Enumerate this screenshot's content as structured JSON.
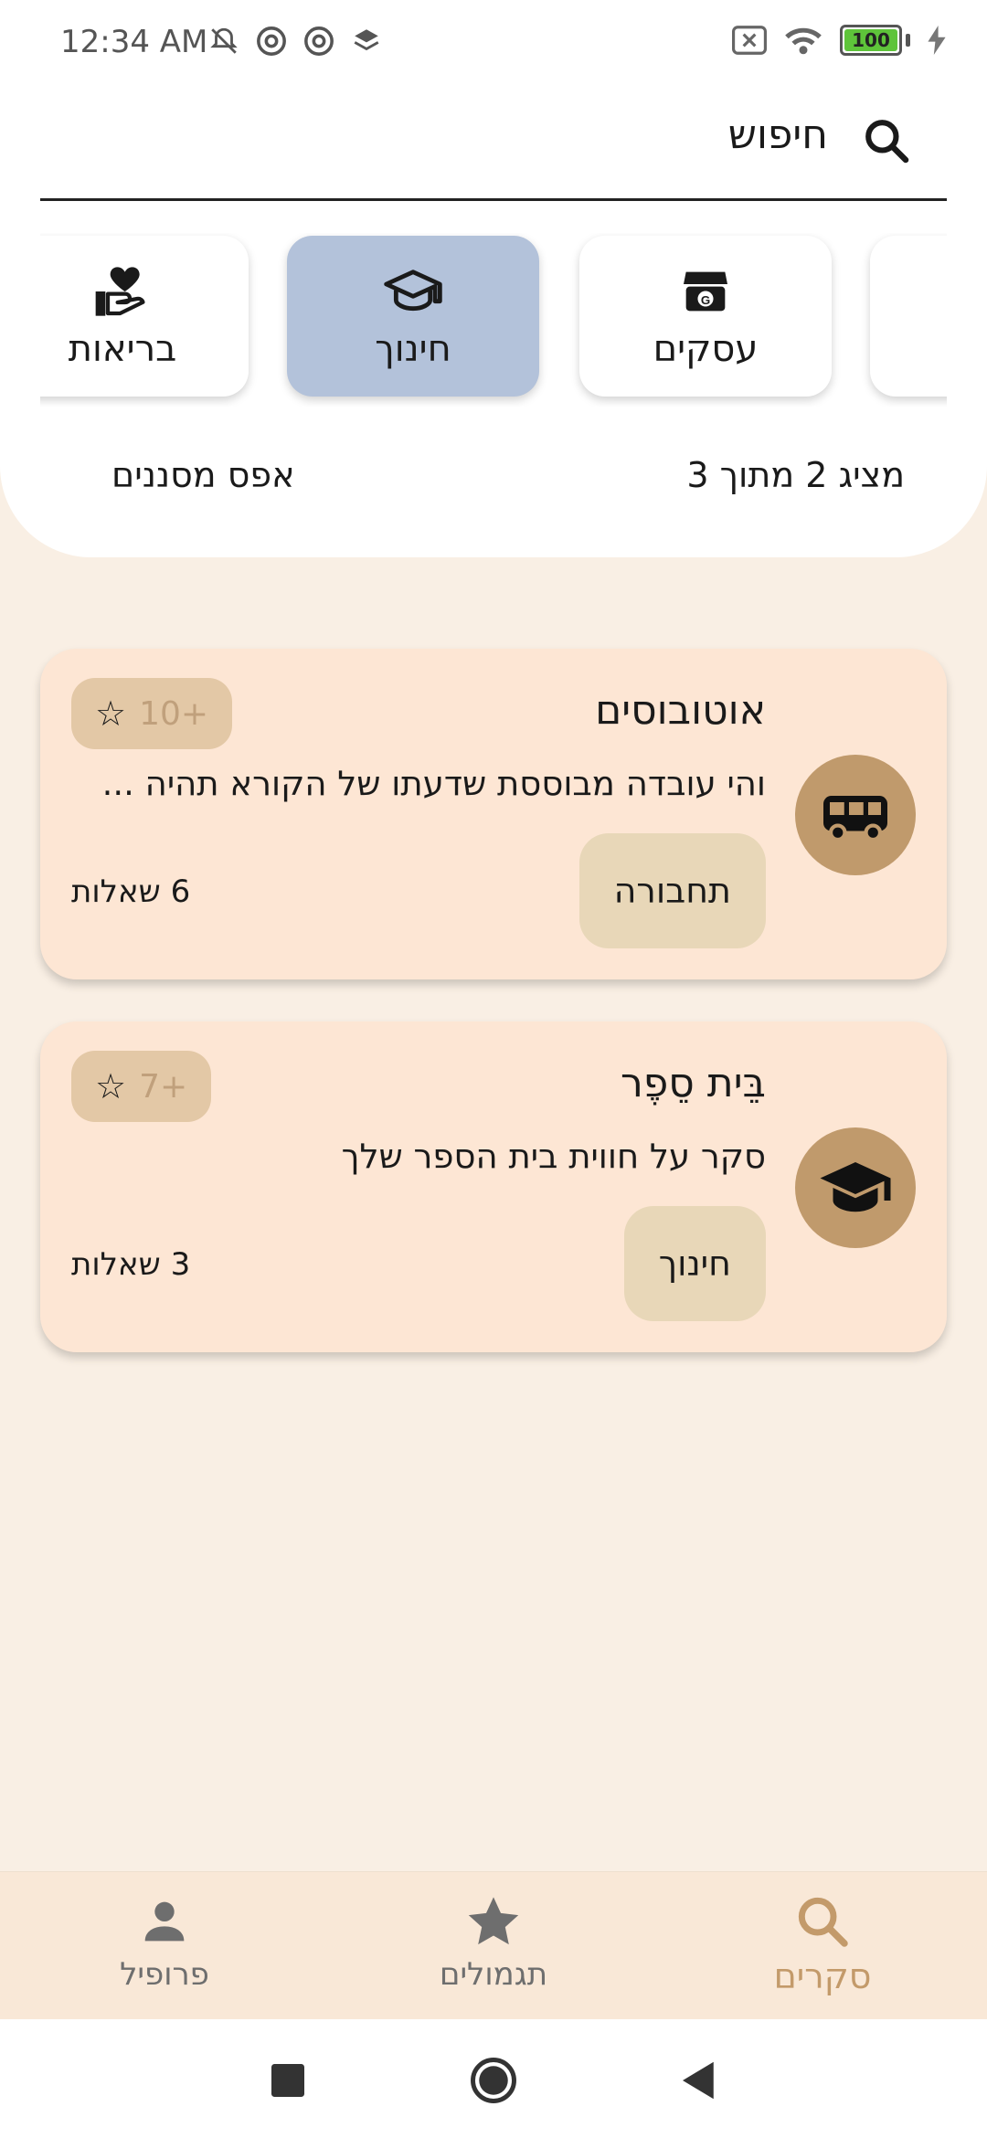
{
  "status_bar": {
    "time": "12:34 AM",
    "battery": "100",
    "left_icons": [
      "muted-bell-icon",
      "at-sign-icon",
      "at-sign-icon",
      "layers-icon"
    ],
    "right_icons": [
      "no-sim-icon",
      "wifi-icon",
      "battery-icon",
      "charging-bolt-icon"
    ]
  },
  "search": {
    "label": "חיפוש"
  },
  "categories": [
    {
      "label": "עסקים",
      "icon": "store-icon",
      "selected": false
    },
    {
      "label": "חינוך",
      "icon": "graduation-cap-icon",
      "selected": true
    },
    {
      "label": "בריאות",
      "icon": "heart-hand-icon",
      "selected": false
    }
  ],
  "summary": {
    "count": "מציג 2 מתוך 3",
    "filters": "אפס מסננים"
  },
  "surveys": [
    {
      "title": "אוטובוסים",
      "description": "והי עובדה מבוססת שדעתו של הקורא תהיה ...",
      "tag": "תחבורה",
      "questions": "6 שאלות",
      "reward": "10+",
      "icon": "bus-icon"
    },
    {
      "title": "בֵּית סֵפֶר",
      "description": "סקר על חווית בית הספר שלך",
      "tag": "חינוך",
      "questions": "3 שאלות",
      "reward": "7+",
      "icon": "graduation-cap-icon"
    }
  ],
  "bottom_nav": {
    "profile": "פרופיל",
    "rewards": "תגמולים",
    "surveys": "סקרים",
    "active": "surveys"
  },
  "colors": {
    "background": "#f9efe4",
    "card": "#fde6d4",
    "accent": "#c39a6a",
    "selected_category": "#b3c2da"
  }
}
